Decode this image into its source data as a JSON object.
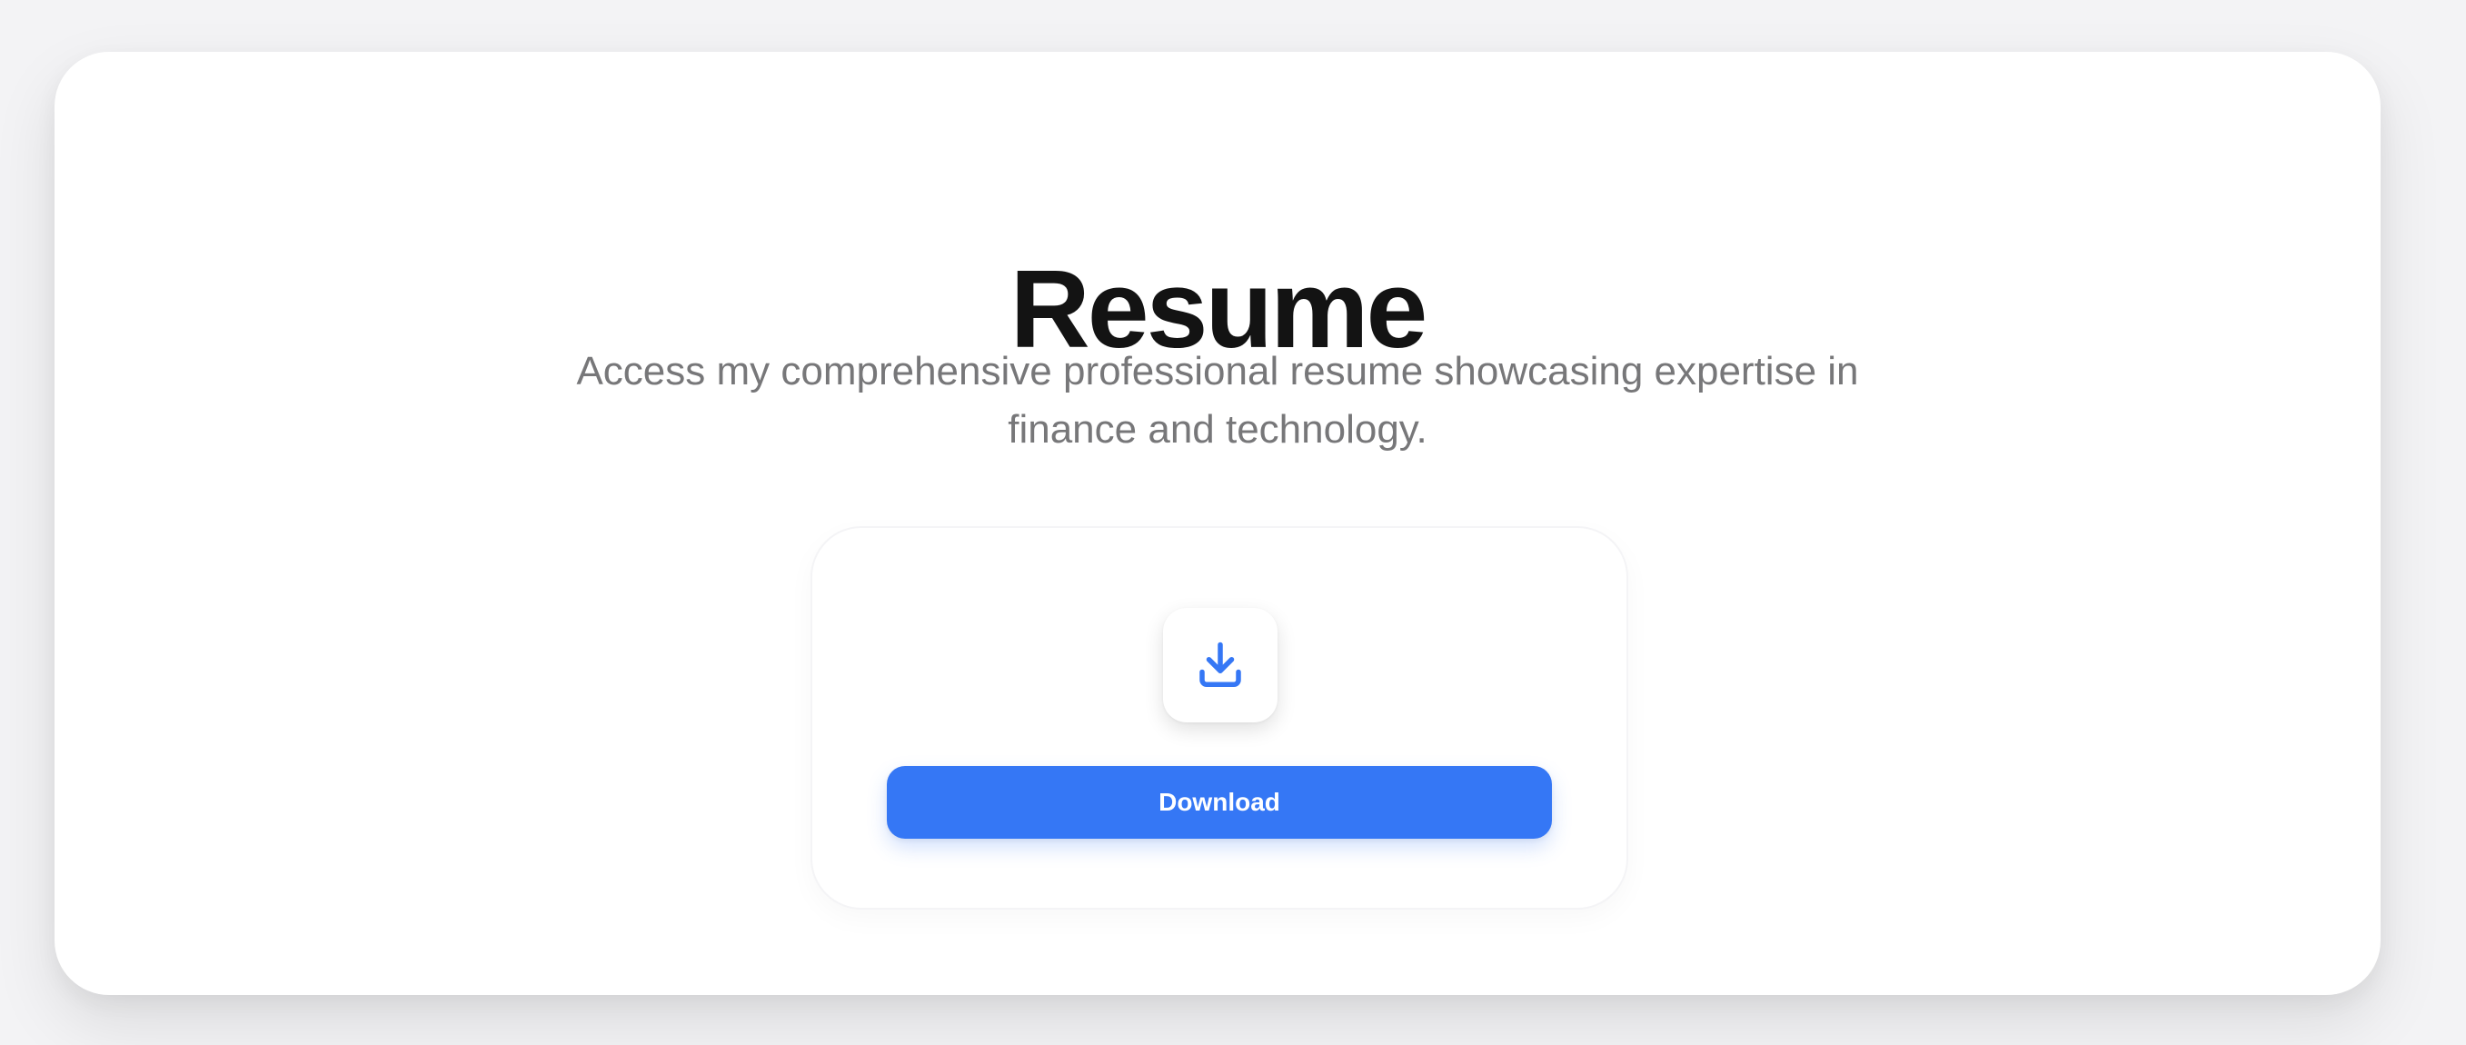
{
  "resume_section": {
    "title": "Resume",
    "subtitle": "Access my comprehensive professional resume showcasing expertise in finance and technology.",
    "download_card": {
      "icon": "download-icon",
      "button_label": "Download"
    }
  },
  "colors": {
    "accent": "#3577f5",
    "title": "#131313",
    "subtitle": "#777779",
    "background": "#f3f3f5",
    "card": "#ffffff"
  }
}
